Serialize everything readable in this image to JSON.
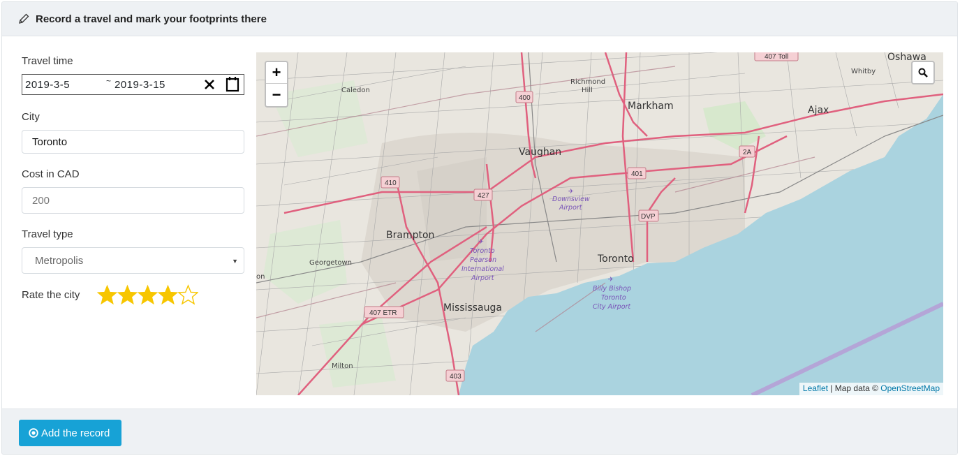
{
  "header": {
    "title": "Record a travel and mark your footprints there",
    "icon": "pencil-icon"
  },
  "form": {
    "travel_time": {
      "label": "Travel time",
      "start": "2019-3-5",
      "separator": "~",
      "end": "2019-3-15"
    },
    "city": {
      "label": "City",
      "value": "Toronto"
    },
    "cost": {
      "label": "Cost in CAD",
      "placeholder": "200"
    },
    "travel_type": {
      "label": "Travel type",
      "selected": "Metropolis"
    },
    "rating": {
      "label": "Rate the city",
      "value": 4,
      "max": 5
    }
  },
  "map": {
    "zoom_in": "+",
    "zoom_out": "−",
    "attribution": {
      "leaflet": "Leaflet",
      "sep": " | Map data © ",
      "osm": "OpenStreetMap"
    },
    "places": {
      "oshawa": "Oshawa",
      "whitby": "Whitby",
      "richmond_hill_1": "Richmond",
      "richmond_hill_2": "Hill",
      "caledon": "Caledon",
      "markham": "Markham",
      "ajax": "Ajax",
      "vaughan": "Vaughan",
      "brampton": "Brampton",
      "georgetown": "Georgetown",
      "toronto": "Toronto",
      "mississauga": "Mississauga",
      "milton": "Milton",
      "on": "on"
    },
    "airports": {
      "downsview_1": "Downsview",
      "downsview_2": "Airport",
      "pearson_1": "Toronto",
      "pearson_2": "Pearson",
      "pearson_3": "International",
      "pearson_4": "Airport",
      "billy_1": "Billy Bishop",
      "billy_2": "Toronto",
      "billy_3": "City Airport"
    },
    "shields": {
      "s407toll": "407 Toll",
      "s400": "400",
      "s410": "410",
      "s427": "427",
      "s401": "401",
      "s2a": "2A",
      "sdvp": "DVP",
      "s407etr": "407 ETR",
      "s403": "403"
    }
  },
  "footer": {
    "add_button": "Add the record"
  },
  "colors": {
    "accent": "#17a2d6",
    "star": "#f7c600",
    "water": "#aad3df",
    "motorway": "#e0607e"
  }
}
